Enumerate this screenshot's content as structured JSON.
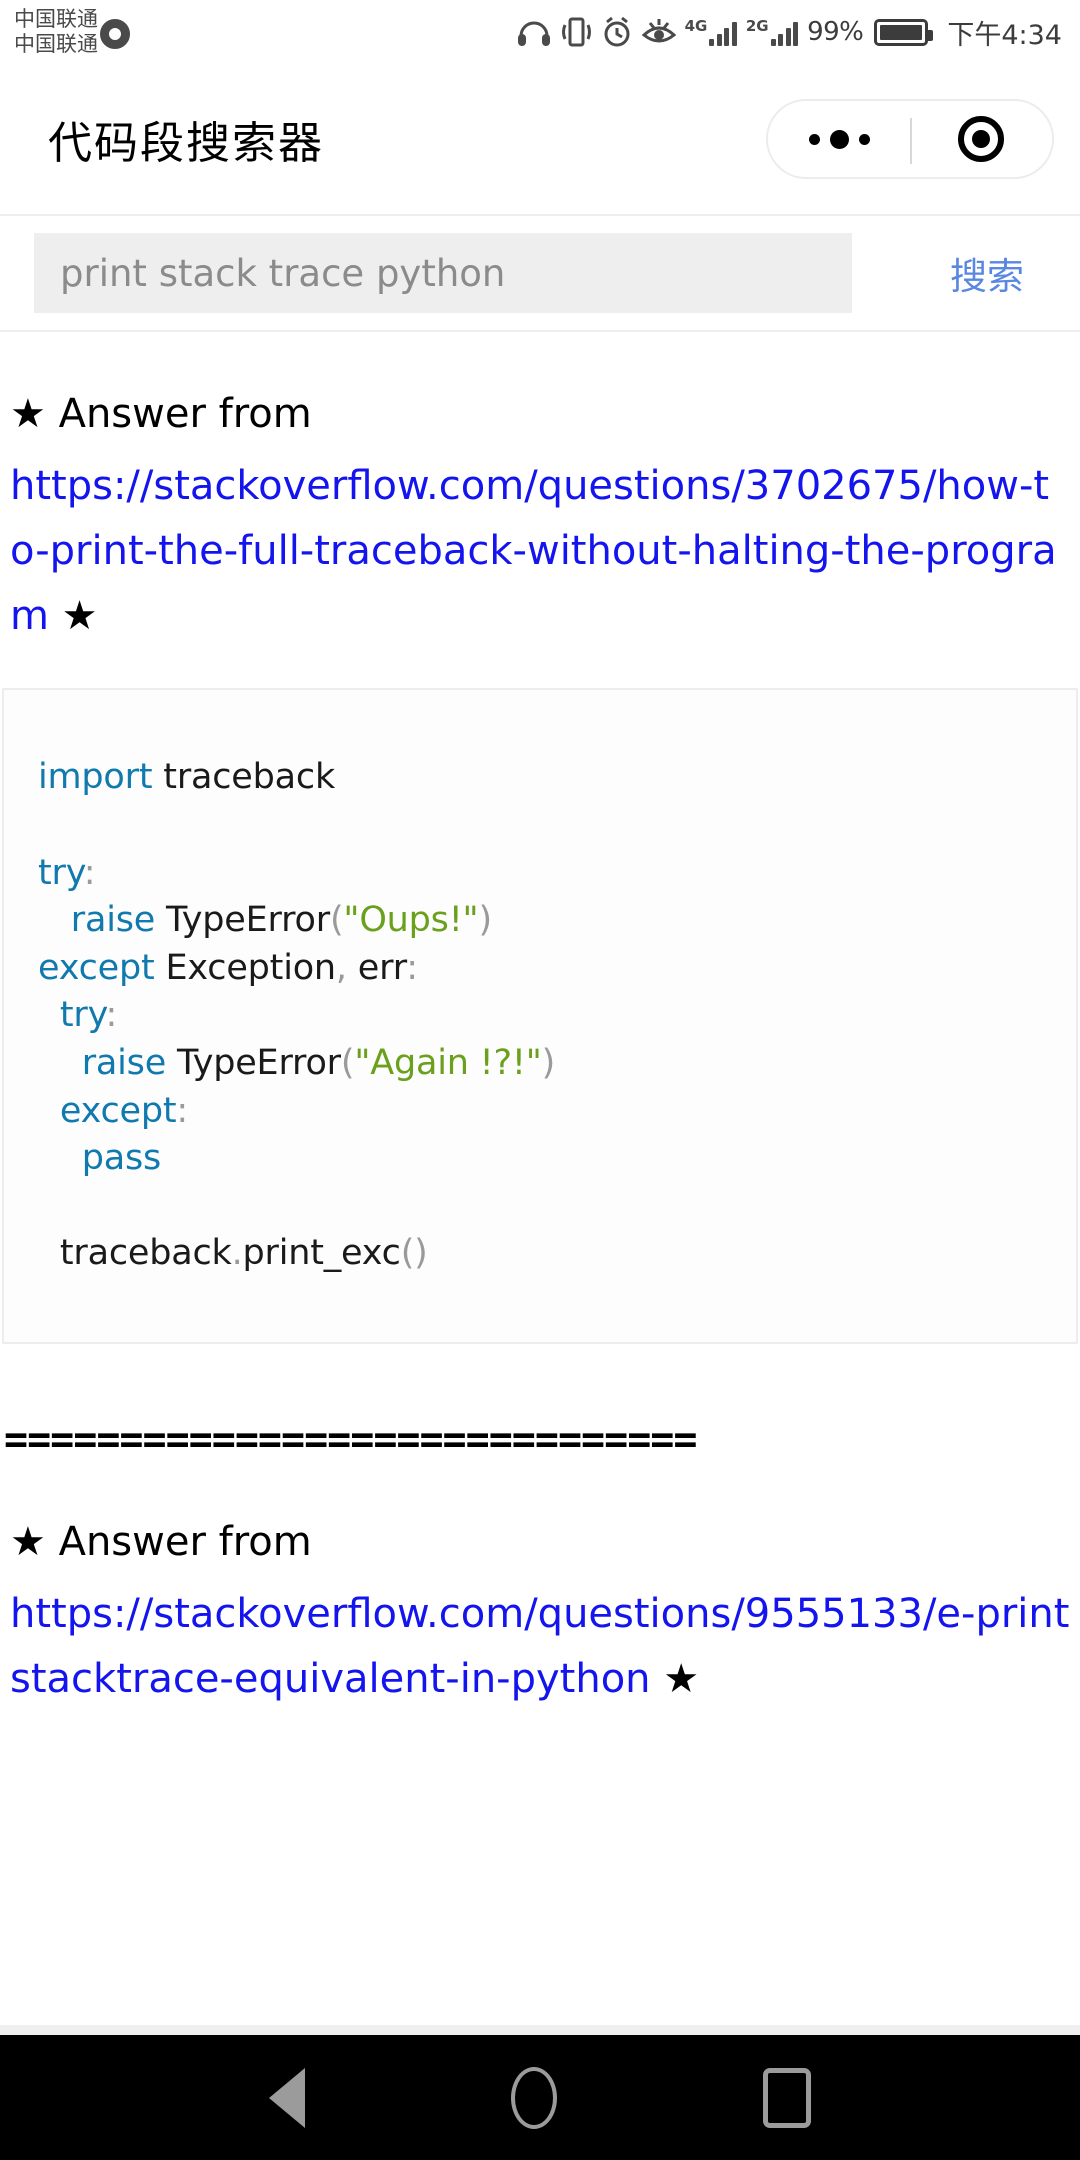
{
  "statusbar": {
    "carrier_line1": "中国联通",
    "carrier_line2": "中国联通",
    "carrier_icon": "dual-sim-icon",
    "icons": [
      "headphones-icon",
      "vibrate-icon",
      "alarm-clock-icon",
      "eye-care-icon"
    ],
    "network1_label": "4G",
    "network1_sub": "↑↓",
    "network2_label": "2G",
    "battery_percent": "99%",
    "battery_icon": "battery-full-icon",
    "clock": "下午4:34"
  },
  "titlebar": {
    "title": "代码段搜索器",
    "capsule": {
      "menu_icon": "more-dots-icon",
      "close_icon": "target-circle-icon"
    }
  },
  "search": {
    "placeholder": "print stack trace python",
    "value": "",
    "button_label": "搜索",
    "button_color": "#5a87e0"
  },
  "results": [
    {
      "heading": "★ Answer from",
      "url": "https://stackoverflow.com/questions/3702675/how-to-print-the-full-traceback-without-halting-the-program",
      "url_star": " ★",
      "code_lines": [
        [
          {
            "t": "import ",
            "c": "k"
          },
          {
            "t": "traceback",
            "c": "n"
          }
        ],
        [],
        [
          {
            "t": "try",
            "c": "k"
          },
          {
            "t": ":",
            "c": "p"
          }
        ],
        [
          {
            "t": "   ",
            "c": "n"
          },
          {
            "t": "raise ",
            "c": "k"
          },
          {
            "t": "TypeError",
            "c": "n"
          },
          {
            "t": "(",
            "c": "p"
          },
          {
            "t": "\"Oups!\"",
            "c": "s"
          },
          {
            "t": ")",
            "c": "p"
          }
        ],
        [
          {
            "t": "except ",
            "c": "k"
          },
          {
            "t": "Exception",
            "c": "n"
          },
          {
            "t": ",",
            "c": "p"
          },
          {
            "t": " err",
            "c": "n"
          },
          {
            "t": ":",
            "c": "p"
          }
        ],
        [
          {
            "t": "  ",
            "c": "n"
          },
          {
            "t": "try",
            "c": "k"
          },
          {
            "t": ":",
            "c": "p"
          }
        ],
        [
          {
            "t": "    ",
            "c": "n"
          },
          {
            "t": "raise ",
            "c": "k"
          },
          {
            "t": "TypeError",
            "c": "n"
          },
          {
            "t": "(",
            "c": "p"
          },
          {
            "t": "\"Again !?!\"",
            "c": "s"
          },
          {
            "t": ")",
            "c": "p"
          }
        ],
        [
          {
            "t": "  ",
            "c": "n"
          },
          {
            "t": "except",
            "c": "k"
          },
          {
            "t": ":",
            "c": "p"
          }
        ],
        [
          {
            "t": "    ",
            "c": "n"
          },
          {
            "t": "pass",
            "c": "k"
          }
        ],
        [],
        [
          {
            "t": "  ",
            "c": "n"
          },
          {
            "t": "traceback",
            "c": "n"
          },
          {
            "t": ".",
            "c": "p"
          },
          {
            "t": "print_exc",
            "c": "n"
          },
          {
            "t": "()",
            "c": "p"
          }
        ]
      ]
    },
    {
      "heading": "★ Answer from",
      "url": "https://stackoverflow.com/questions/9555133/e-printstacktrace-equivalent-in-python",
      "url_star": " ★"
    }
  ],
  "divider": "==============================",
  "navbar": {
    "back_icon": "back-triangle-icon",
    "home_icon": "home-circle-icon",
    "recents_icon": "recents-square-icon"
  },
  "colors": {
    "link": "#1414ef",
    "keyword": "#1079ae",
    "string": "#6aa01b",
    "punct": "#9a9a9a",
    "search_button": "#5a87e0"
  }
}
